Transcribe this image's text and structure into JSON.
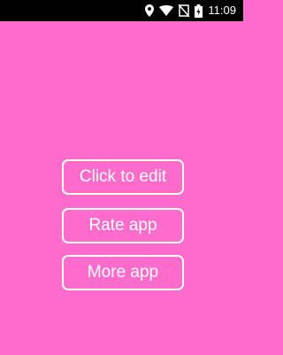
{
  "status_bar": {
    "time": "11:09",
    "icons": [
      "location-icon",
      "wifi-icon",
      "no-sim-icon",
      "battery-icon"
    ]
  },
  "buttons": {
    "edit_label": "Click to edit",
    "rate_label": "Rate app",
    "more_label": "More app"
  },
  "colors": {
    "background": "#ff6ccb",
    "button_border": "#ffffff",
    "status_bar": "#000000"
  }
}
